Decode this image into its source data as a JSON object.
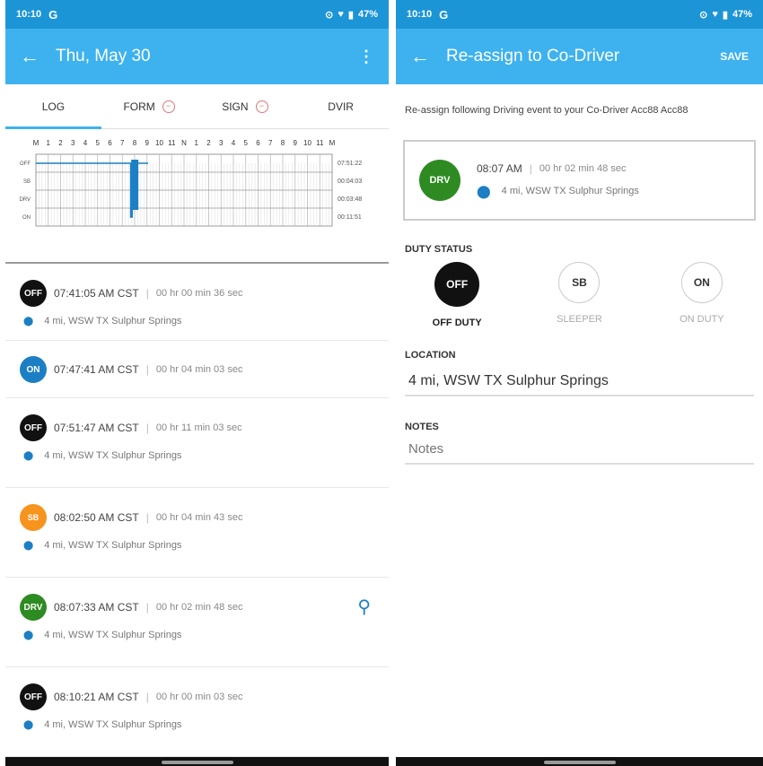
{
  "left": {
    "status_time": "10:10",
    "status_icon": "G",
    "status_battery": "47%",
    "appbar_title": "Thu, May 30",
    "tabs": [
      {
        "label": "LOG",
        "active": true,
        "alert": false
      },
      {
        "label": "FORM",
        "active": false,
        "alert": true
      },
      {
        "label": "SIGN",
        "active": false,
        "alert": true
      },
      {
        "label": "DVIR",
        "active": false,
        "alert": false
      }
    ],
    "graph": {
      "hour_labels": [
        "M",
        "1",
        "2",
        "3",
        "4",
        "5",
        "6",
        "7",
        "8",
        "9",
        "10",
        "11",
        "N",
        "1",
        "2",
        "3",
        "4",
        "5",
        "6",
        "7",
        "8",
        "9",
        "10",
        "11",
        "M"
      ],
      "row_labels": [
        "OFF",
        "SB",
        "DRV",
        "ON"
      ],
      "totals": [
        "07:51:22",
        "00:04:03",
        "00:03:48",
        "00:11:51"
      ]
    },
    "events": [
      {
        "badge": "OFF",
        "color": "#111111",
        "time": "07:41:05 AM CST",
        "duration": "00 hr 00 min 36 sec",
        "location": "4 mi, WSW TX Sulphur Springs",
        "codriver": false
      },
      {
        "badge": "ON",
        "color": "#1c7fc4",
        "time": "07:47:41 AM CST",
        "duration": "00 hr 04 min 03 sec",
        "location": "",
        "codriver": false
      },
      {
        "badge": "OFF",
        "color": "#111111",
        "time": "07:51:47 AM CST",
        "duration": "00 hr 11 min 03 sec",
        "location": "4 mi, WSW TX Sulphur Springs",
        "codriver": false
      },
      {
        "badge": "SB",
        "color": "#f7941d",
        "time": "08:02:50 AM CST",
        "duration": "00 hr 04 min 43 sec",
        "location": "4 mi, WSW TX Sulphur Springs",
        "codriver": false
      },
      {
        "badge": "DRV",
        "color": "#2e8b22",
        "time": "08:07:33 AM CST",
        "duration": "00 hr 02 min 48 sec",
        "location": "4 mi, WSW TX Sulphur Springs",
        "codriver": true
      },
      {
        "badge": "OFF",
        "color": "#111111",
        "time": "08:10:21 AM CST",
        "duration": "00 hr 00 min 03 sec",
        "location": "4 mi, WSW TX Sulphur Springs",
        "codriver": false
      }
    ]
  },
  "right": {
    "status_time": "10:10",
    "status_icon": "G",
    "status_battery": "47%",
    "appbar_title": "Re-assign to Co-Driver",
    "save_label": "SAVE",
    "description": "Re-assign following Driving event to your Co-Driver Acc88 Acc88",
    "event": {
      "badge": "DRV",
      "color": "#2e8b22",
      "time": "08:07 AM",
      "duration": "00 hr 02 min 48 sec",
      "location": "4 mi, WSW TX Sulphur Springs"
    },
    "duty_status_label": "DUTY STATUS",
    "duty_options": [
      {
        "code": "OFF",
        "label": "OFF DUTY",
        "selected": true
      },
      {
        "code": "SB",
        "label": "SLEEPER",
        "selected": false
      },
      {
        "code": "ON",
        "label": "ON DUTY",
        "selected": false
      }
    ],
    "location_label": "LOCATION",
    "location_value": "4 mi, WSW TX Sulphur Springs",
    "notes_label": "NOTES",
    "notes_placeholder": "Notes"
  }
}
